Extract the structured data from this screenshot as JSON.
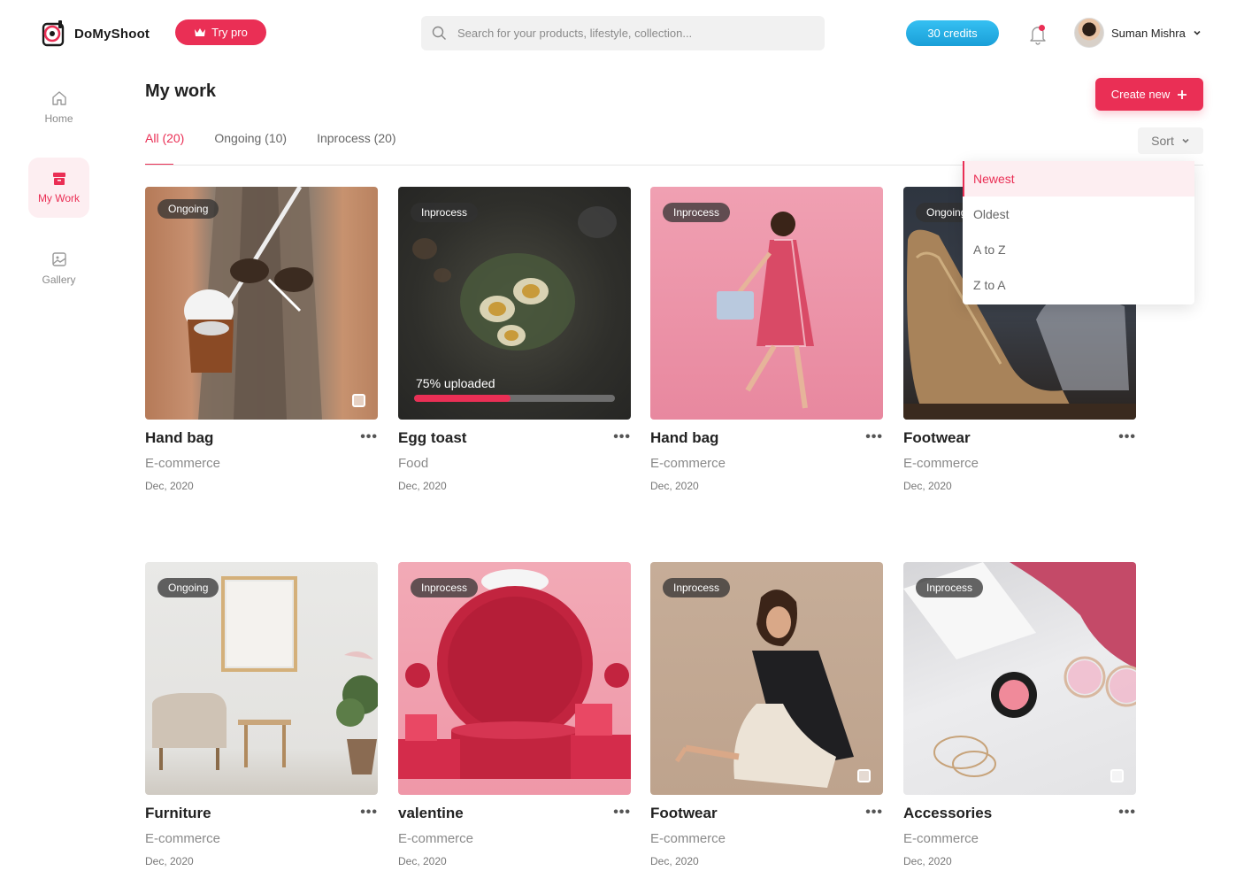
{
  "brand": {
    "name": "DoMyShoot"
  },
  "header": {
    "try_pro": "Try pro",
    "search_placeholder": "Search for your products, lifestyle, collection...",
    "credits": "30 credits",
    "user_name": "Suman Mishra"
  },
  "sidebar": {
    "items": [
      {
        "label": "Home",
        "icon": "home-icon"
      },
      {
        "label": "My Work",
        "icon": "box-icon"
      },
      {
        "label": "Gallery",
        "icon": "image-icon"
      }
    ]
  },
  "main": {
    "title": "My work",
    "create_label": "Create new",
    "tabs": [
      {
        "label": "All (20)"
      },
      {
        "label": "Ongoing (10)"
      },
      {
        "label": "Inprocess (20)"
      }
    ],
    "sort_label": "Sort",
    "sort_options": [
      "Newest",
      "Oldest",
      "A to Z",
      "Z to A"
    ]
  },
  "cards": [
    {
      "title": "Hand bag",
      "category": "E-commerce",
      "date": "Dec, 2020",
      "status": "Ongoing"
    },
    {
      "title": "Egg toast",
      "category": "Food",
      "date": "Dec, 2020",
      "status": "Inprocess",
      "upload_text": "75% uploaded",
      "progress": 0.48
    },
    {
      "title": "Hand bag",
      "category": "E-commerce",
      "date": "Dec, 2020",
      "status": "Inprocess"
    },
    {
      "title": "Footwear",
      "category": "E-commerce",
      "date": "Dec, 2020",
      "status": "Ongoing"
    },
    {
      "title": "Furniture",
      "category": "E-commerce",
      "date": "Dec, 2020",
      "status": "Ongoing"
    },
    {
      "title": "valentine",
      "category": "E-commerce",
      "date": "Dec, 2020",
      "status": "Inprocess"
    },
    {
      "title": "Footwear",
      "category": "E-commerce",
      "date": "Dec, 2020",
      "status": "Inprocess"
    },
    {
      "title": "Accessories",
      "category": "E-commerce",
      "date": "Dec, 2020",
      "status": "Inprocess"
    }
  ],
  "colors": {
    "accent": "#ea2f55",
    "credits": "#1a9fd8"
  }
}
